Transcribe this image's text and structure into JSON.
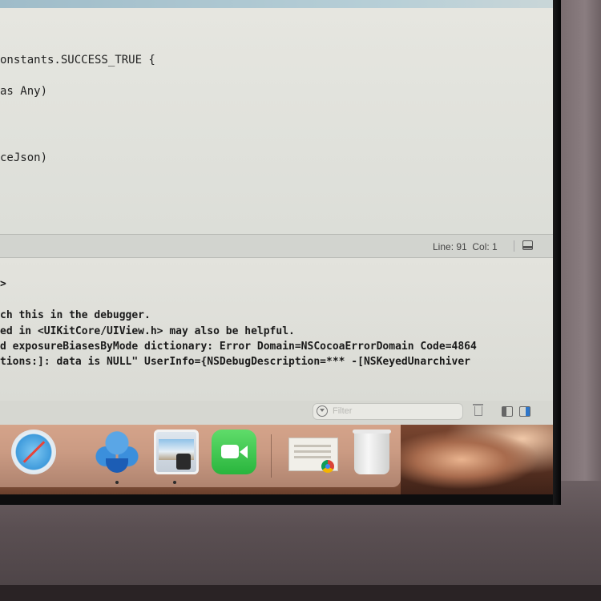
{
  "editor": {
    "lines": [
      "onstants.SUCCESS_TRUE {",
      "as Any)",
      "ceJson)"
    ]
  },
  "status_bar": {
    "position_text": "Line: 91  Col: 1"
  },
  "console": {
    "lines": [
      ">",
      "ch this in the debugger.",
      "ed in <UIKitCore/UIView.h> may also be helpful.",
      "d exposureBiasesByMode dictionary: Error Domain=NSCocoaErrorDomain Code=4864",
      "tions:]: data is NULL\" UserInfo={NSDebugDescription=*** -[NSKeyedUnarchiver"
    ],
    "filter_placeholder": "Filter"
  },
  "dock": {
    "apps": [
      {
        "icon": "safari-icon"
      },
      {
        "icon": "xcode-icon",
        "running": true
      },
      {
        "icon": "preview-icon",
        "running": true
      },
      {
        "icon": "facetime-icon"
      }
    ],
    "recent": [
      {
        "icon": "document-thumbnail-icon"
      },
      {
        "icon": "chrome-badge-icon"
      },
      {
        "icon": "trash-icon"
      }
    ]
  },
  "colors": {
    "editor_background": "#e6e6e0",
    "console_text": "#1a1a1a",
    "dock_tint": "#c99070",
    "accent_blue": "#2f76c9"
  }
}
